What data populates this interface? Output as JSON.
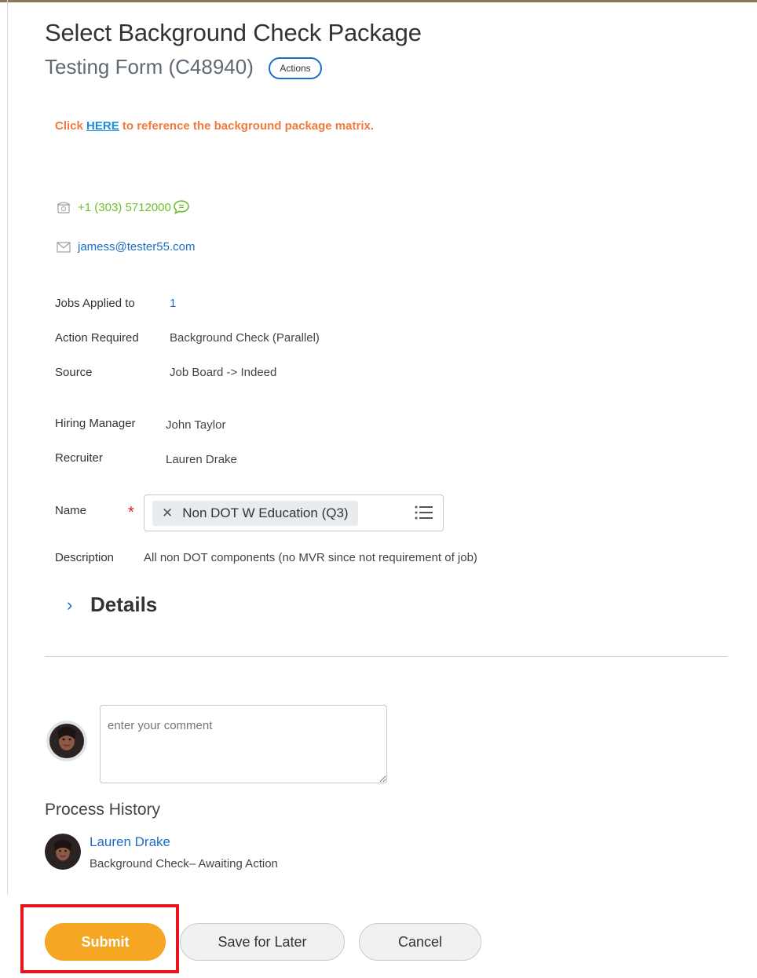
{
  "header": {
    "title": "Select Background Check Package",
    "subtitle": "Testing Form (C48940)",
    "actions_label": "Actions"
  },
  "notice": {
    "prefix": "Click ",
    "link": "HERE",
    "suffix": " to reference the background package matrix."
  },
  "contact": {
    "phone": "+1 (303) 5712000",
    "email": "jamess@tester55.com"
  },
  "fields": {
    "jobs_applied_label": "Jobs Applied to",
    "jobs_applied_value": "1",
    "action_required_label": "Action Required",
    "action_required_value": "Background Check (Parallel)",
    "source_label": "Source",
    "source_value": "Job Board -> Indeed",
    "hiring_manager_label": "Hiring Manager",
    "hiring_manager_value": "John Taylor",
    "recruiter_label": "Recruiter",
    "recruiter_value": "Lauren Drake",
    "name_label": "Name",
    "required_marker": "*",
    "name_selected": "Non DOT W Education (Q3)",
    "description_label": "Description",
    "description_value": "All non DOT components (no MVR since not requirement of job)"
  },
  "details": {
    "label": "Details"
  },
  "comment": {
    "placeholder": "enter your comment"
  },
  "process_history": {
    "title": "Process History",
    "entries": [
      {
        "name": "Lauren Drake",
        "status": "Background Check– Awaiting Action"
      }
    ]
  },
  "buttons": {
    "submit": "Submit",
    "save_later": "Save for Later",
    "cancel": "Cancel"
  },
  "colors": {
    "accent_orange": "#f5a623",
    "link_blue": "#1a6ec8",
    "notice_orange": "#f5793b",
    "phone_green": "#6cbf2b",
    "highlight_red": "#e8141b"
  },
  "icons": {
    "phone": "phone-icon",
    "chat": "chat-bubble-icon",
    "email": "envelope-icon",
    "remove": "close-icon",
    "prompt": "list-icon",
    "expand": "chevron-right-icon"
  }
}
